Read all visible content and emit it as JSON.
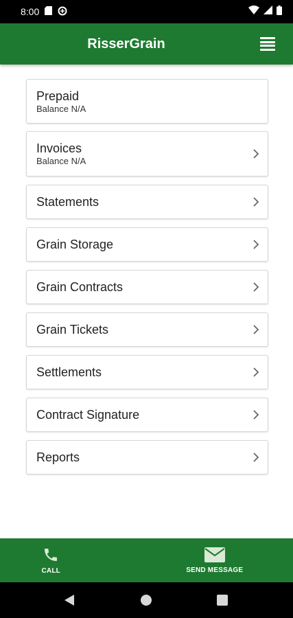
{
  "status_bar": {
    "time": "8:00",
    "icons": [
      "sd-card-icon",
      "data-saver-icon",
      "wifi-icon",
      "signal-icon",
      "battery-icon"
    ]
  },
  "app_bar": {
    "title": "RisserGrain",
    "menu_icon": "hamburger-menu-icon"
  },
  "menu_items": [
    {
      "title": "Prepaid",
      "subtitle": "Balance N/A",
      "has_chevron": false
    },
    {
      "title": "Invoices",
      "subtitle": "Balance N/A",
      "has_chevron": true
    },
    {
      "title": "Statements",
      "has_chevron": true
    },
    {
      "title": "Grain Storage",
      "has_chevron": true
    },
    {
      "title": "Grain Contracts",
      "has_chevron": true
    },
    {
      "title": "Grain Tickets",
      "has_chevron": true
    },
    {
      "title": "Settlements",
      "has_chevron": true
    },
    {
      "title": "Contract Signature",
      "has_chevron": true
    },
    {
      "title": "Reports",
      "has_chevron": true
    }
  ],
  "bottom_bar": {
    "call_label": "CALL",
    "call_icon": "phone-icon",
    "message_label": "SEND MESSAGE",
    "message_icon": "envelope-icon"
  },
  "nav_bar": {
    "icons": [
      "back-icon",
      "home-icon",
      "recents-icon"
    ]
  },
  "colors": {
    "brand_green": "#1e7a31",
    "card_border": "#d6d6d6",
    "chevron": "#666666"
  }
}
